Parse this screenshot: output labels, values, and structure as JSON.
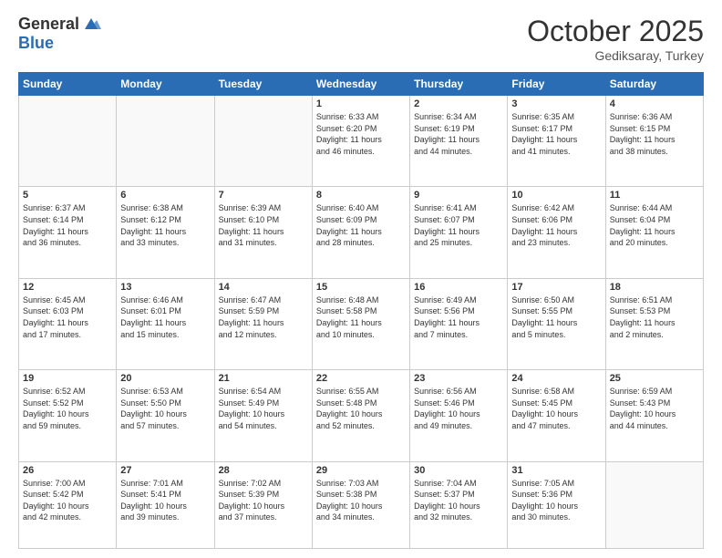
{
  "logo": {
    "general": "General",
    "blue": "Blue"
  },
  "header": {
    "month": "October 2025",
    "location": "Gediksaray, Turkey"
  },
  "weekdays": [
    "Sunday",
    "Monday",
    "Tuesday",
    "Wednesday",
    "Thursday",
    "Friday",
    "Saturday"
  ],
  "weeks": [
    [
      {
        "day": "",
        "info": ""
      },
      {
        "day": "",
        "info": ""
      },
      {
        "day": "",
        "info": ""
      },
      {
        "day": "1",
        "info": "Sunrise: 6:33 AM\nSunset: 6:20 PM\nDaylight: 11 hours\nand 46 minutes."
      },
      {
        "day": "2",
        "info": "Sunrise: 6:34 AM\nSunset: 6:19 PM\nDaylight: 11 hours\nand 44 minutes."
      },
      {
        "day": "3",
        "info": "Sunrise: 6:35 AM\nSunset: 6:17 PM\nDaylight: 11 hours\nand 41 minutes."
      },
      {
        "day": "4",
        "info": "Sunrise: 6:36 AM\nSunset: 6:15 PM\nDaylight: 11 hours\nand 38 minutes."
      }
    ],
    [
      {
        "day": "5",
        "info": "Sunrise: 6:37 AM\nSunset: 6:14 PM\nDaylight: 11 hours\nand 36 minutes."
      },
      {
        "day": "6",
        "info": "Sunrise: 6:38 AM\nSunset: 6:12 PM\nDaylight: 11 hours\nand 33 minutes."
      },
      {
        "day": "7",
        "info": "Sunrise: 6:39 AM\nSunset: 6:10 PM\nDaylight: 11 hours\nand 31 minutes."
      },
      {
        "day": "8",
        "info": "Sunrise: 6:40 AM\nSunset: 6:09 PM\nDaylight: 11 hours\nand 28 minutes."
      },
      {
        "day": "9",
        "info": "Sunrise: 6:41 AM\nSunset: 6:07 PM\nDaylight: 11 hours\nand 25 minutes."
      },
      {
        "day": "10",
        "info": "Sunrise: 6:42 AM\nSunset: 6:06 PM\nDaylight: 11 hours\nand 23 minutes."
      },
      {
        "day": "11",
        "info": "Sunrise: 6:44 AM\nSunset: 6:04 PM\nDaylight: 11 hours\nand 20 minutes."
      }
    ],
    [
      {
        "day": "12",
        "info": "Sunrise: 6:45 AM\nSunset: 6:03 PM\nDaylight: 11 hours\nand 17 minutes."
      },
      {
        "day": "13",
        "info": "Sunrise: 6:46 AM\nSunset: 6:01 PM\nDaylight: 11 hours\nand 15 minutes."
      },
      {
        "day": "14",
        "info": "Sunrise: 6:47 AM\nSunset: 5:59 PM\nDaylight: 11 hours\nand 12 minutes."
      },
      {
        "day": "15",
        "info": "Sunrise: 6:48 AM\nSunset: 5:58 PM\nDaylight: 11 hours\nand 10 minutes."
      },
      {
        "day": "16",
        "info": "Sunrise: 6:49 AM\nSunset: 5:56 PM\nDaylight: 11 hours\nand 7 minutes."
      },
      {
        "day": "17",
        "info": "Sunrise: 6:50 AM\nSunset: 5:55 PM\nDaylight: 11 hours\nand 5 minutes."
      },
      {
        "day": "18",
        "info": "Sunrise: 6:51 AM\nSunset: 5:53 PM\nDaylight: 11 hours\nand 2 minutes."
      }
    ],
    [
      {
        "day": "19",
        "info": "Sunrise: 6:52 AM\nSunset: 5:52 PM\nDaylight: 10 hours\nand 59 minutes."
      },
      {
        "day": "20",
        "info": "Sunrise: 6:53 AM\nSunset: 5:50 PM\nDaylight: 10 hours\nand 57 minutes."
      },
      {
        "day": "21",
        "info": "Sunrise: 6:54 AM\nSunset: 5:49 PM\nDaylight: 10 hours\nand 54 minutes."
      },
      {
        "day": "22",
        "info": "Sunrise: 6:55 AM\nSunset: 5:48 PM\nDaylight: 10 hours\nand 52 minutes."
      },
      {
        "day": "23",
        "info": "Sunrise: 6:56 AM\nSunset: 5:46 PM\nDaylight: 10 hours\nand 49 minutes."
      },
      {
        "day": "24",
        "info": "Sunrise: 6:58 AM\nSunset: 5:45 PM\nDaylight: 10 hours\nand 47 minutes."
      },
      {
        "day": "25",
        "info": "Sunrise: 6:59 AM\nSunset: 5:43 PM\nDaylight: 10 hours\nand 44 minutes."
      }
    ],
    [
      {
        "day": "26",
        "info": "Sunrise: 7:00 AM\nSunset: 5:42 PM\nDaylight: 10 hours\nand 42 minutes."
      },
      {
        "day": "27",
        "info": "Sunrise: 7:01 AM\nSunset: 5:41 PM\nDaylight: 10 hours\nand 39 minutes."
      },
      {
        "day": "28",
        "info": "Sunrise: 7:02 AM\nSunset: 5:39 PM\nDaylight: 10 hours\nand 37 minutes."
      },
      {
        "day": "29",
        "info": "Sunrise: 7:03 AM\nSunset: 5:38 PM\nDaylight: 10 hours\nand 34 minutes."
      },
      {
        "day": "30",
        "info": "Sunrise: 7:04 AM\nSunset: 5:37 PM\nDaylight: 10 hours\nand 32 minutes."
      },
      {
        "day": "31",
        "info": "Sunrise: 7:05 AM\nSunset: 5:36 PM\nDaylight: 10 hours\nand 30 minutes."
      },
      {
        "day": "",
        "info": ""
      }
    ]
  ]
}
